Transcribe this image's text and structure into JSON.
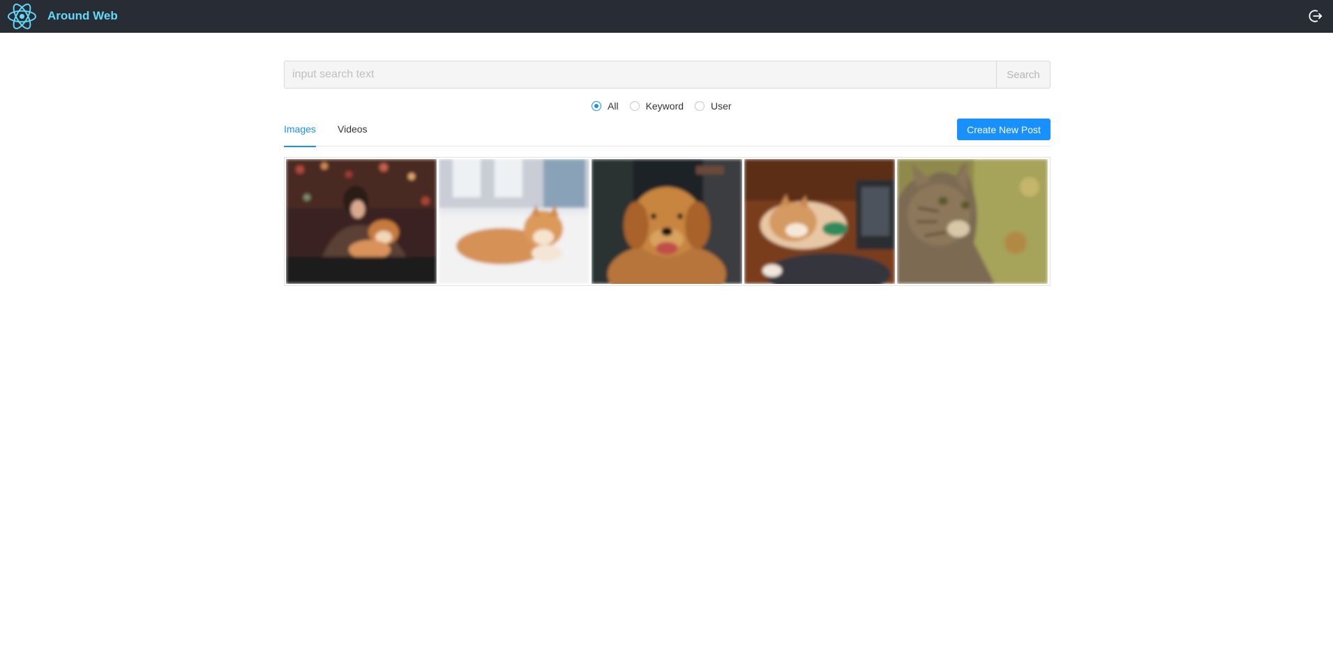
{
  "header": {
    "app_title": "Around Web",
    "logo_icon": "react-atom-icon",
    "logout_icon": "logout-icon",
    "accent_color": "#61dafb",
    "bg_color": "#282c34"
  },
  "search": {
    "placeholder": "input search text",
    "value": "",
    "button_label": "Search"
  },
  "filter": {
    "options": [
      {
        "label": "All",
        "checked": true
      },
      {
        "label": "Keyword",
        "checked": false
      },
      {
        "label": "User",
        "checked": false
      }
    ]
  },
  "tabs": {
    "items": [
      {
        "label": "Images",
        "active": true
      },
      {
        "label": "Videos",
        "active": false
      }
    ],
    "create_label": "Create New Post",
    "primary_color": "#1890ff"
  },
  "gallery": {
    "images": [
      {
        "subject": "woman-with-shiba-dog-photo"
      },
      {
        "subject": "shiba-dog-on-rug-photo"
      },
      {
        "subject": "golden-retriever-photo"
      },
      {
        "subject": "shiba-dog-with-laptop-photo"
      },
      {
        "subject": "tabby-cat-photo"
      }
    ]
  }
}
